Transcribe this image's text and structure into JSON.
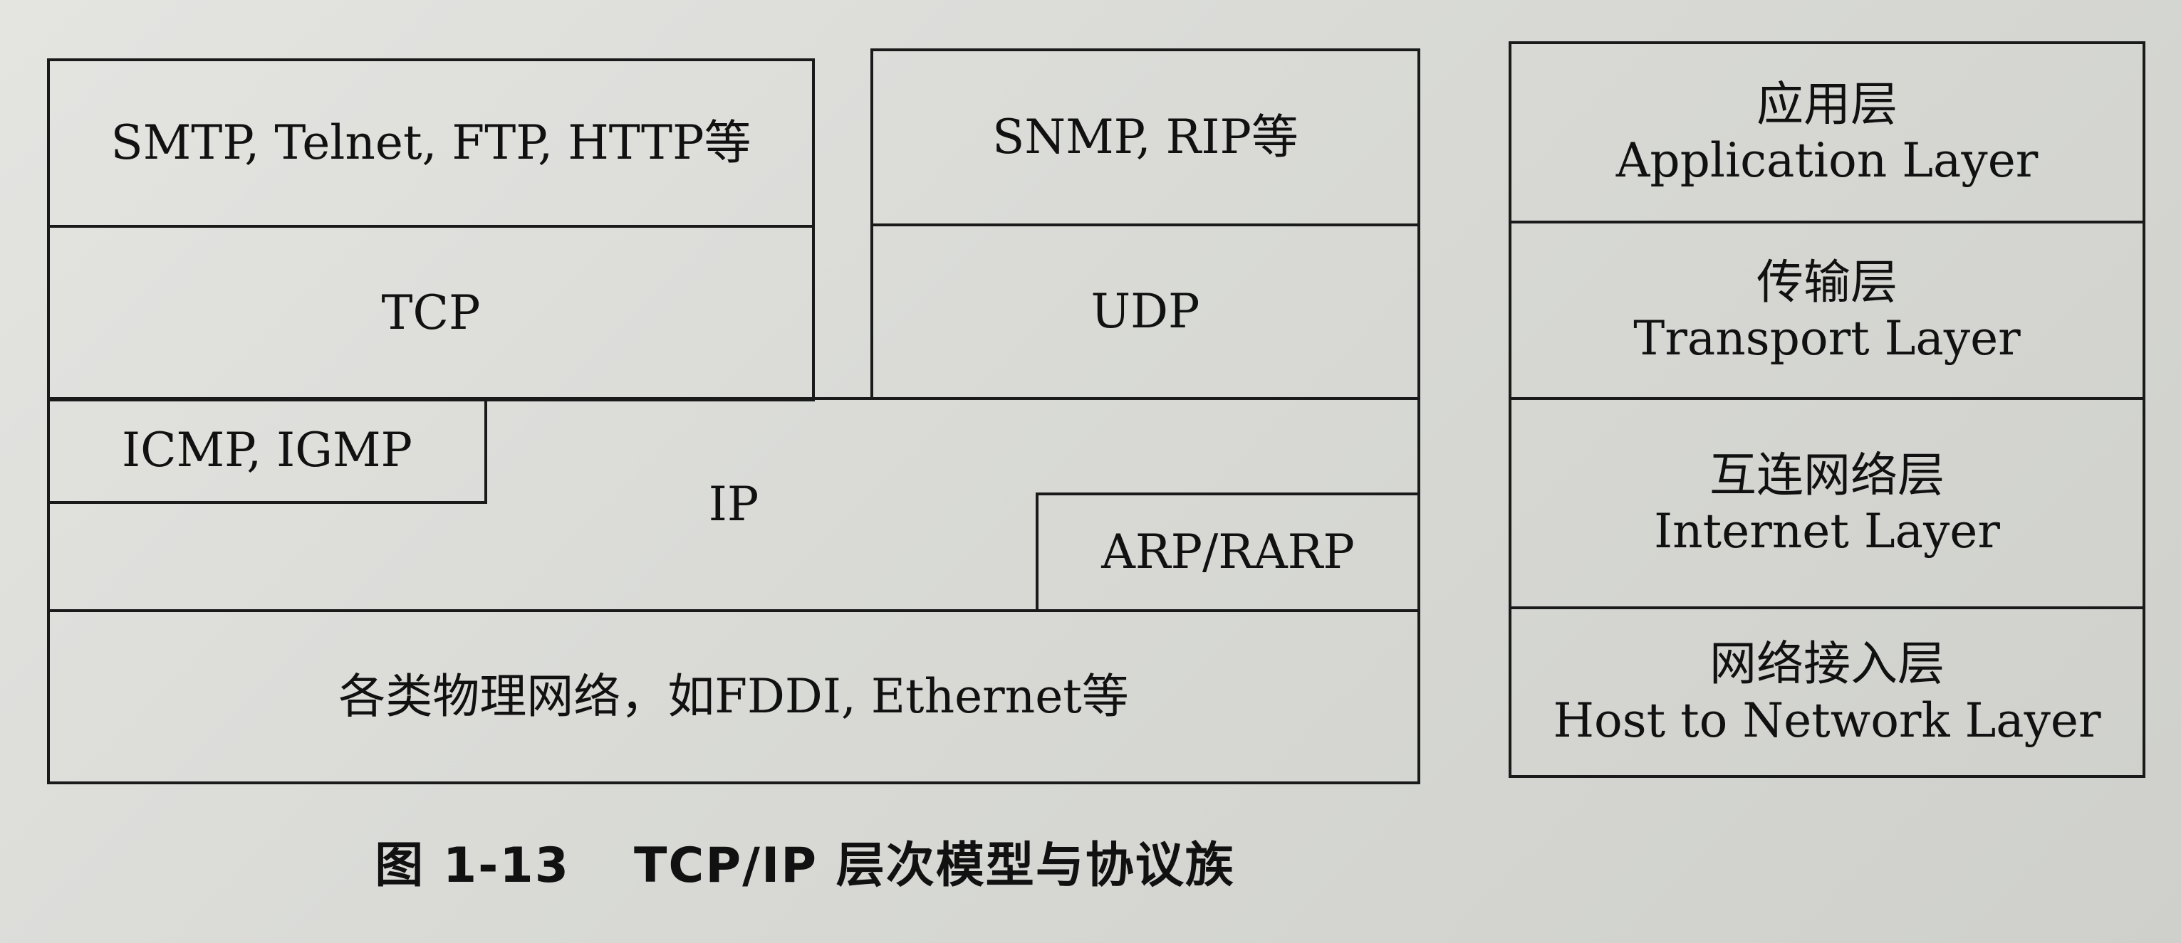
{
  "protocols": {
    "smtp_group": "SMTP, Telnet, FTP, HTTP等",
    "snmp_group": "SNMP, RIP等",
    "tcp": "TCP",
    "udp": "UDP",
    "icmp_igmp": "ICMP, IGMP",
    "ip": "IP",
    "arp_rarp": "ARP/RARP",
    "physical": "各类物理网络，如FDDI, Ethernet等"
  },
  "layers": [
    {
      "cn": "应用层",
      "en": "Application Layer"
    },
    {
      "cn": "传输层",
      "en": "Transport Layer"
    },
    {
      "cn": "互连网络层",
      "en": "Internet Layer"
    },
    {
      "cn": "网络接入层",
      "en": "Host to Network Layer"
    }
  ],
  "caption": {
    "number": "图 1-13",
    "text": "TCP/IP 层次模型与协议族"
  }
}
